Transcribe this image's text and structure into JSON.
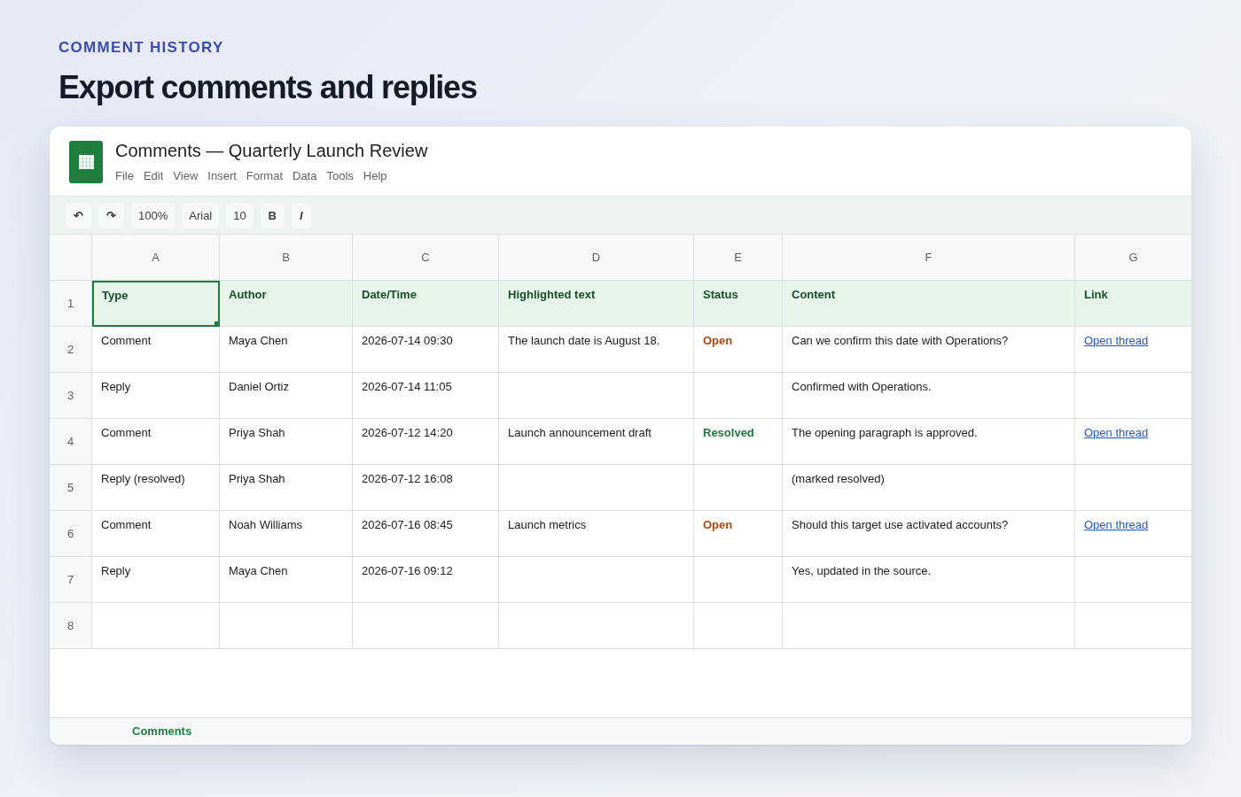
{
  "page_header": {
    "eyebrow": "COMMENT HISTORY",
    "title": "Export comments and replies"
  },
  "window": {
    "title": "Comments — Quarterly Launch Review",
    "menu": [
      "File",
      "Edit",
      "View",
      "Insert",
      "Format",
      "Data",
      "Tools",
      "Help"
    ]
  },
  "toolbar": [
    {
      "kind": "undo",
      "label": "↶"
    },
    {
      "kind": "redo",
      "label": "↷"
    },
    {
      "kind": "zoom",
      "label": "100%"
    },
    {
      "kind": "font",
      "label": "Arial"
    },
    {
      "kind": "size",
      "label": "10"
    },
    {
      "kind": "bold",
      "label": "B"
    },
    {
      "kind": "italic",
      "label": "I"
    }
  ],
  "sheet": {
    "columns": [
      "A",
      "B",
      "C",
      "D",
      "E",
      "F",
      "G"
    ],
    "rows": [
      {
        "number": "1",
        "kind": "header",
        "cells": [
          {
            "kind": "text",
            "text": "Type",
            "selected": true
          },
          {
            "kind": "text",
            "text": "Author",
            "selected": false
          },
          {
            "kind": "text",
            "text": "Date/Time",
            "selected": false
          },
          {
            "kind": "text",
            "text": "Highlighted text",
            "selected": false
          },
          {
            "kind": "text",
            "text": "Status",
            "selected": false
          },
          {
            "kind": "text",
            "text": "Content",
            "selected": false
          },
          {
            "kind": "text",
            "text": "Link",
            "selected": false
          }
        ]
      },
      {
        "number": "2",
        "kind": "data",
        "cells": [
          {
            "kind": "text",
            "text": "Comment",
            "selected": false
          },
          {
            "kind": "text",
            "text": "Maya Chen",
            "selected": false
          },
          {
            "kind": "text",
            "text": "2026-07-14 09:30",
            "selected": false
          },
          {
            "kind": "text",
            "text": "The launch date is August 18.",
            "selected": false
          },
          {
            "kind": "status",
            "text": "Open",
            "color": "#b0480c",
            "selected": false
          },
          {
            "kind": "text",
            "text": "Can we confirm this date with Operations?",
            "selected": false
          },
          {
            "kind": "link",
            "text": "Open thread",
            "selected": false
          }
        ]
      },
      {
        "number": "3",
        "kind": "data",
        "cells": [
          {
            "kind": "text",
            "text": "Reply",
            "selected": false
          },
          {
            "kind": "text",
            "text": "Daniel Ortiz",
            "selected": false
          },
          {
            "kind": "text",
            "text": "2026-07-14 11:05",
            "selected": false
          },
          {
            "kind": "empty",
            "selected": false
          },
          {
            "kind": "empty",
            "selected": false
          },
          {
            "kind": "text",
            "text": "Confirmed with Operations.",
            "selected": false
          },
          {
            "kind": "empty",
            "selected": false
          }
        ]
      },
      {
        "number": "4",
        "kind": "data",
        "cells": [
          {
            "kind": "text",
            "text": "Comment",
            "selected": false
          },
          {
            "kind": "text",
            "text": "Priya Shah",
            "selected": false
          },
          {
            "kind": "text",
            "text": "2026-07-12 14:20",
            "selected": false
          },
          {
            "kind": "text",
            "text": "Launch announcement draft",
            "selected": false
          },
          {
            "kind": "status",
            "text": "Resolved",
            "color": "#1e7a3c",
            "selected": false
          },
          {
            "kind": "text",
            "text": "The opening paragraph is approved.",
            "selected": false
          },
          {
            "kind": "link",
            "text": "Open thread",
            "selected": false
          }
        ]
      },
      {
        "number": "5",
        "kind": "data",
        "cells": [
          {
            "kind": "text",
            "text": "Reply (resolved)",
            "selected": false
          },
          {
            "kind": "text",
            "text": "Priya Shah",
            "selected": false
          },
          {
            "kind": "text",
            "text": "2026-07-12 16:08",
            "selected": false
          },
          {
            "kind": "empty",
            "selected": false
          },
          {
            "kind": "empty",
            "selected": false
          },
          {
            "kind": "text",
            "text": "(marked resolved)",
            "selected": false
          },
          {
            "kind": "empty",
            "selected": false
          }
        ]
      },
      {
        "number": "6",
        "kind": "data",
        "cells": [
          {
            "kind": "text",
            "text": "Comment",
            "selected": false
          },
          {
            "kind": "text",
            "text": "Noah Williams",
            "selected": false
          },
          {
            "kind": "text",
            "text": "2026-07-16 08:45",
            "selected": false
          },
          {
            "kind": "text",
            "text": "Launch metrics",
            "selected": false
          },
          {
            "kind": "status",
            "text": "Open",
            "color": "#b0480c",
            "selected": false
          },
          {
            "kind": "text",
            "text": "Should this target use activated accounts?",
            "selected": false
          },
          {
            "kind": "link",
            "text": "Open thread",
            "selected": false
          }
        ]
      },
      {
        "number": "7",
        "kind": "data",
        "cells": [
          {
            "kind": "text",
            "text": "Reply",
            "selected": false
          },
          {
            "kind": "text",
            "text": "Maya Chen",
            "selected": false
          },
          {
            "kind": "text",
            "text": "2026-07-16 09:12",
            "selected": false
          },
          {
            "kind": "empty",
            "selected": false
          },
          {
            "kind": "empty",
            "selected": false
          },
          {
            "kind": "text",
            "text": "Yes, updated in the source.",
            "selected": false
          },
          {
            "kind": "empty",
            "selected": false
          }
        ]
      },
      {
        "number": "8",
        "kind": "data",
        "cells": [
          {
            "kind": "empty",
            "selected": false
          },
          {
            "kind": "empty",
            "selected": false
          },
          {
            "kind": "empty",
            "selected": false
          },
          {
            "kind": "empty",
            "selected": false
          },
          {
            "kind": "empty",
            "selected": false
          },
          {
            "kind": "empty",
            "selected": false
          },
          {
            "kind": "empty",
            "selected": false
          }
        ]
      }
    ]
  },
  "sheet_tabs": [
    {
      "label": "Comments",
      "selected": true
    }
  ]
}
